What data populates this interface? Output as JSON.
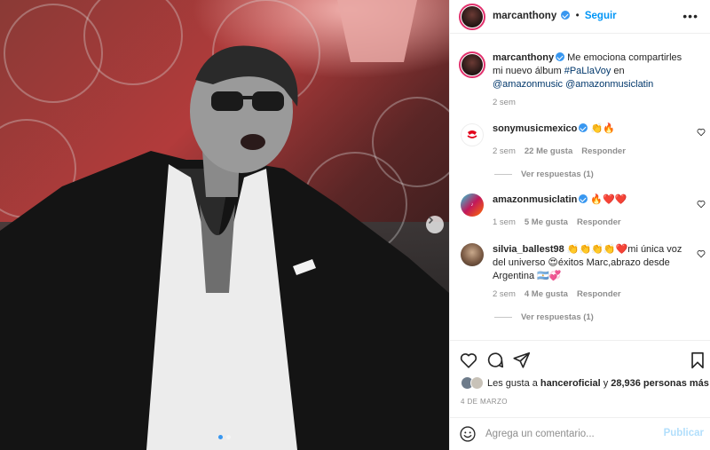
{
  "post": {
    "author": "marcanthony",
    "follow_label": "Seguir",
    "more_label": "•••",
    "caption_text": "Me emociona compartirles mi nuevo álbum",
    "caption_hashtag": "#PaLlaVoy",
    "caption_mid": "en",
    "caption_mention1": "@amazonmusic",
    "caption_mention2": "@amazonmusiclatin",
    "caption_time": "2 sem"
  },
  "comments": [
    {
      "user": "sonymusicmexico",
      "verified": true,
      "text": "👏🔥",
      "time": "2 sem",
      "likes": "22 Me gusta",
      "reply_label": "Responder",
      "view_replies": "Ver respuestas (1)"
    },
    {
      "user": "amazonmusiclatin",
      "verified": true,
      "text": "🔥❤️❤️",
      "time": "1 sem",
      "likes": "5 Me gusta",
      "reply_label": "Responder"
    },
    {
      "user": "silvia_ballest98",
      "verified": false,
      "text": "👏👏👏👏❤️mi única voz del universo 😍éxitos Marc,abrazo desde Argentina 🇦🇷💞",
      "time": "2 sem",
      "likes": "4 Me gusta",
      "reply_label": "Responder",
      "view_replies": "Ver respuestas (1)"
    }
  ],
  "likes_bar": {
    "prefix": "Les gusta a",
    "liker": "hanceroficial",
    "connector": "y",
    "count": "28,936 personas más"
  },
  "date": "4 DE MARZO",
  "add_comment": {
    "placeholder": "Agrega un comentario...",
    "publish_label": "Publicar"
  },
  "icons": {
    "like": "heart-icon",
    "comment": "comment-icon",
    "share": "paper-plane-icon",
    "save": "bookmark-icon",
    "emoji": "smiley-icon",
    "next": "chevron-right-icon"
  },
  "colors": {
    "accent": "#0095f6",
    "verified": "#3897f0",
    "link": "#00376b",
    "muted": "#8e8e8e",
    "publish_disabled": "#b2dffc"
  }
}
